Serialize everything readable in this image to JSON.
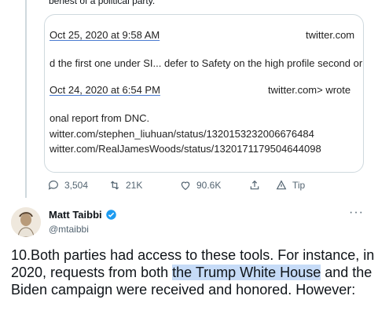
{
  "top_cut_text": "benest of a political party.",
  "email": {
    "line1_date": "Oct 25, 2020 at 9:58 AM",
    "line1_right": "twitter.com",
    "line2": "d the first one under SI... defer to Safety on the high profile second or",
    "line3_date": "Oct 24, 2020 at 6:54 PM",
    "line3_right": "twitter.com> wrote",
    "line4": "onal report from DNC.",
    "line5": "witter.com/stephen_liuhuan/status/1320153232006676484",
    "line6": "witter.com/RealJamesWoods/status/1320171179504644098"
  },
  "actions": {
    "replies": "3,504",
    "retweets": "21K",
    "likes": "90.6K",
    "tip": "Tip"
  },
  "author": {
    "name": "Matt Taibbi",
    "handle": "@mtaibbi"
  },
  "tweet": {
    "part1": "10.Both parties had access to these tools. For instance, in 2020, requests from both ",
    "highlight": "the Trump White House",
    "part2": " and the Biden campaign were received and honored. However:"
  },
  "colors": {
    "highlight": "#c6dbf7",
    "verified": "#1d9bf0"
  }
}
